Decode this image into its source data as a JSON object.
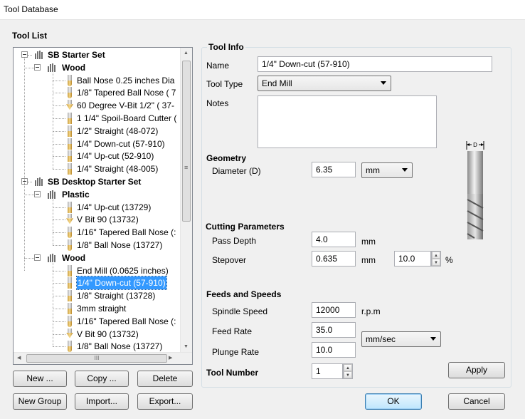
{
  "window": {
    "title": "Tool Database"
  },
  "tool_list": {
    "label": "Tool List",
    "groups": [
      {
        "name": "SB Starter Set",
        "subgroups": [
          {
            "name": "Wood",
            "tools": [
              {
                "name": "Ball Nose 0.25 inches Dia",
                "icon": "ball-nose"
              },
              {
                "name": "1/8\" Tapered Ball Nose ( 7",
                "icon": "ball-nose"
              },
              {
                "name": "60 Degree V-Bit 1/2\"  ( 37-",
                "icon": "v-bit"
              },
              {
                "name": "1 1/4\" Spoil-Board Cutter (",
                "icon": "end-mill"
              },
              {
                "name": "1/2\" Straight  (48-072)",
                "icon": "end-mill"
              },
              {
                "name": "1/4\"  Down-cut (57-910)",
                "icon": "end-mill"
              },
              {
                "name": "1/4\" Up-cut (52-910)",
                "icon": "end-mill"
              },
              {
                "name": "1/4\" Straight  (48-005)",
                "icon": "end-mill"
              }
            ]
          }
        ]
      },
      {
        "name": "SB Desktop Starter Set",
        "subgroups": [
          {
            "name": "Plastic",
            "tools": [
              {
                "name": "1/4\" Up-cut (13729)",
                "icon": "end-mill"
              },
              {
                "name": "V Bit 90 (13732)",
                "icon": "v-bit"
              },
              {
                "name": "1/16\" Tapered Ball Nose (:",
                "icon": "ball-nose"
              },
              {
                "name": "1/8\" Ball Nose (13727)",
                "icon": "ball-nose"
              }
            ]
          },
          {
            "name": "Wood",
            "tools": [
              {
                "name": "End Mill (0.0625 inches)",
                "icon": "end-mill"
              },
              {
                "name": "1/4\"  Down-cut (57-910)",
                "icon": "end-mill",
                "selected": true
              },
              {
                "name": "1/8\" Straight (13728)",
                "icon": "end-mill"
              },
              {
                "name": "3mm straight",
                "icon": "end-mill"
              },
              {
                "name": "1/16\" Tapered Ball Nose (:",
                "icon": "ball-nose"
              },
              {
                "name": "V Bit 90 (13732)",
                "icon": "v-bit"
              },
              {
                "name": "1/8\" Ball Nose (13727)",
                "icon": "ball-nose"
              }
            ]
          }
        ]
      }
    ],
    "hscroll_grip": "III",
    "buttons": {
      "new": "New ...",
      "copy": "Copy ...",
      "delete": "Delete",
      "new_group": "New Group",
      "import": "Import...",
      "export": "Export..."
    }
  },
  "tool_info": {
    "label": "Tool Info",
    "name_label": "Name",
    "name_value": "1/4\"  Down-cut (57-910)",
    "type_label": "Tool Type",
    "type_value": "End Mill",
    "notes_label": "Notes",
    "notes_value": "",
    "diagram_dim_label": "D"
  },
  "geometry": {
    "label": "Geometry",
    "diameter_label": "Diameter (D)",
    "diameter_value": "6.35",
    "units_value": "mm"
  },
  "cutting": {
    "label": "Cutting Parameters",
    "pass_depth_label": "Pass Depth",
    "pass_depth_value": "4.0",
    "pass_depth_unit": "mm",
    "stepover_label": "Stepover",
    "stepover_value": "0.635",
    "stepover_unit": "mm",
    "stepover_percent_value": "10.0",
    "stepover_percent_unit": "%"
  },
  "feeds": {
    "label": "Feeds and Speeds",
    "spindle_label": "Spindle Speed",
    "spindle_value": "12000",
    "spindle_unit": "r.p.m",
    "feed_label": "Feed Rate",
    "feed_value": "35.0",
    "plunge_label": "Plunge Rate",
    "plunge_value": "10.0",
    "rate_units_value": "mm/sec"
  },
  "tool_number": {
    "label": "Tool Number",
    "value": "1"
  },
  "dialog_buttons": {
    "apply": "Apply",
    "ok": "OK",
    "cancel": "Cancel"
  }
}
